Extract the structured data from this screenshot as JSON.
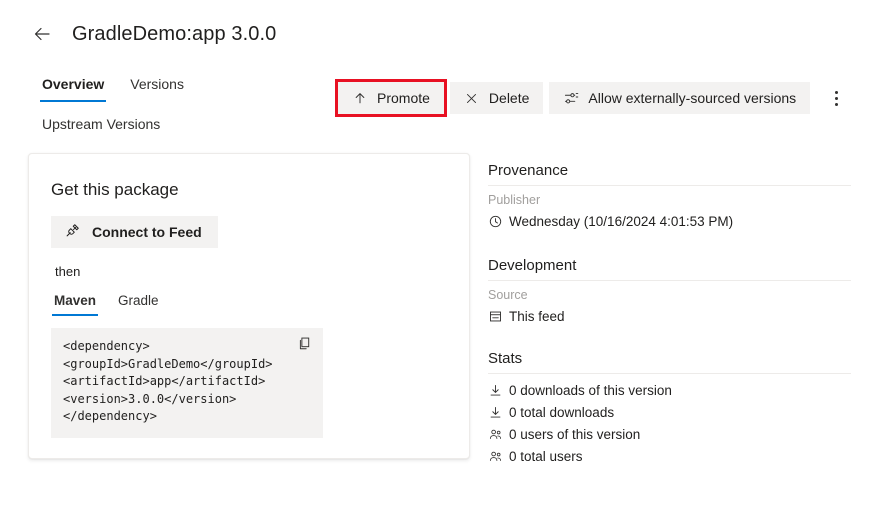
{
  "header": {
    "back_icon": "arrow-left-icon",
    "title": "GradleDemo:app 3.0.0"
  },
  "tabs": [
    {
      "label": "Overview",
      "active": true
    },
    {
      "label": "Versions",
      "active": false
    }
  ],
  "subtabs": [
    {
      "label": "Upstream Versions"
    }
  ],
  "commandbar": {
    "promote": {
      "label": "Promote",
      "icon": "arrow-up-icon",
      "highlighted": true,
      "highlight_color": "#e81123"
    },
    "delete": {
      "label": "Delete",
      "icon": "close-x-icon"
    },
    "allow_external": {
      "label": "Allow externally-sourced versions",
      "icon": "settings-sliders-icon"
    },
    "overflow": {
      "icon": "more-vertical-icon"
    }
  },
  "card": {
    "title": "Get this package",
    "connect_button": {
      "label": "Connect to Feed",
      "icon": "plug-connect-icon"
    },
    "then_text": "then",
    "code_tabs": [
      {
        "label": "Maven",
        "active": true
      },
      {
        "label": "Gradle",
        "active": false
      }
    ],
    "code": "<dependency>\n<groupId>GradleDemo</groupId>\n<artifactId>app</artifactId>\n<version>3.0.0</version>\n</dependency>",
    "copy_icon": "copy-icon"
  },
  "side": {
    "provenance": {
      "title": "Provenance",
      "label": "Publisher",
      "value": "Wednesday (10/16/2024 4:01:53 PM)",
      "icon": "clock-icon"
    },
    "development": {
      "title": "Development",
      "label": "Source",
      "value": "This feed",
      "icon": "feed-icon"
    },
    "stats": {
      "title": "Stats",
      "items": [
        {
          "icon": "download-icon",
          "label": "0 downloads of this version"
        },
        {
          "icon": "download-icon",
          "label": "0 total downloads"
        },
        {
          "icon": "people-icon",
          "label": "0 users of this version"
        },
        {
          "icon": "people-icon",
          "label": "0 total users"
        }
      ]
    }
  }
}
